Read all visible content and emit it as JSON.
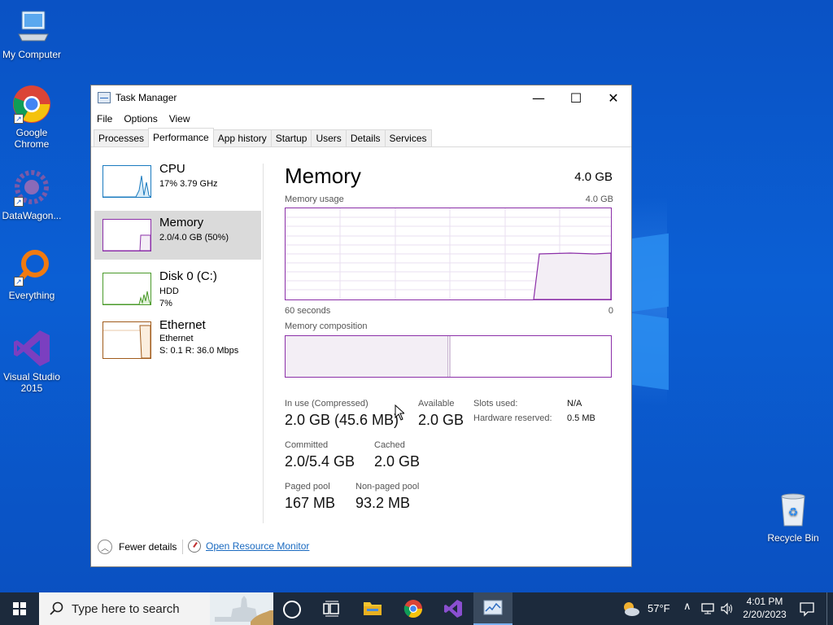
{
  "desktop": {
    "icons": [
      {
        "label": "My Computer"
      },
      {
        "label": "Google Chrome"
      },
      {
        "label": "DataWagon..."
      },
      {
        "label": "Everything"
      },
      {
        "label": "Visual Studio 2015"
      },
      {
        "label": "Recycle Bin"
      }
    ]
  },
  "window": {
    "title": "Task Manager",
    "controls": {
      "minimize": "—",
      "maximize": "☐",
      "close": "✕"
    },
    "menu": [
      "File",
      "Options",
      "View"
    ],
    "tabs": [
      "Processes",
      "Performance",
      "App history",
      "Startup",
      "Users",
      "Details",
      "Services"
    ],
    "active_tab": "Performance"
  },
  "sidebar": {
    "items": [
      {
        "name": "CPU",
        "sub1": "17%  3.79 GHz",
        "sub2": "",
        "color": "#1a7abf"
      },
      {
        "name": "Memory",
        "sub1": "2.0/4.0 GB (50%)",
        "sub2": "",
        "color": "#8b2fa8"
      },
      {
        "name": "Disk 0 (C:)",
        "sub1": "HDD",
        "sub2": "7%",
        "color": "#4a9a2a"
      },
      {
        "name": "Ethernet",
        "sub1": "Ethernet",
        "sub2": "S: 0.1  R: 36.0 Mbps",
        "color": "#a05a1a"
      }
    ],
    "selected": "Memory"
  },
  "main": {
    "title": "Memory",
    "total": "4.0 GB",
    "usage_label": "Memory usage",
    "usage_max": "4.0 GB",
    "axis_left": "60 seconds",
    "axis_right": "0",
    "composition_label": "Memory composition",
    "stats": {
      "in_use_label": "In use (Compressed)",
      "in_use_value": "2.0 GB (45.6 MB)",
      "available_label": "Available",
      "available_value": "2.0 GB",
      "committed_label": "Committed",
      "committed_value": "2.0/5.4 GB",
      "cached_label": "Cached",
      "cached_value": "2.0 GB",
      "paged_label": "Paged pool",
      "paged_value": "167 MB",
      "nonpaged_label": "Non-paged pool",
      "nonpaged_value": "93.2 MB",
      "slots_label": "Slots used:",
      "slots_value": "N/A",
      "reserved_label": "Hardware reserved:",
      "reserved_value": "0.5 MB"
    },
    "usage_fraction": 0.5
  },
  "footer": {
    "fewer_details": "Fewer details",
    "resource_monitor": "Open Resource Monitor"
  },
  "taskbar": {
    "search_placeholder": "Type here to search",
    "weather": "57°F",
    "time": "4:01 PM",
    "date": "2/20/2023"
  },
  "colors": {
    "memory_accent": "#8b2fa8",
    "desktop_blue": "#0a52c4",
    "link": "#1a6ac0"
  }
}
